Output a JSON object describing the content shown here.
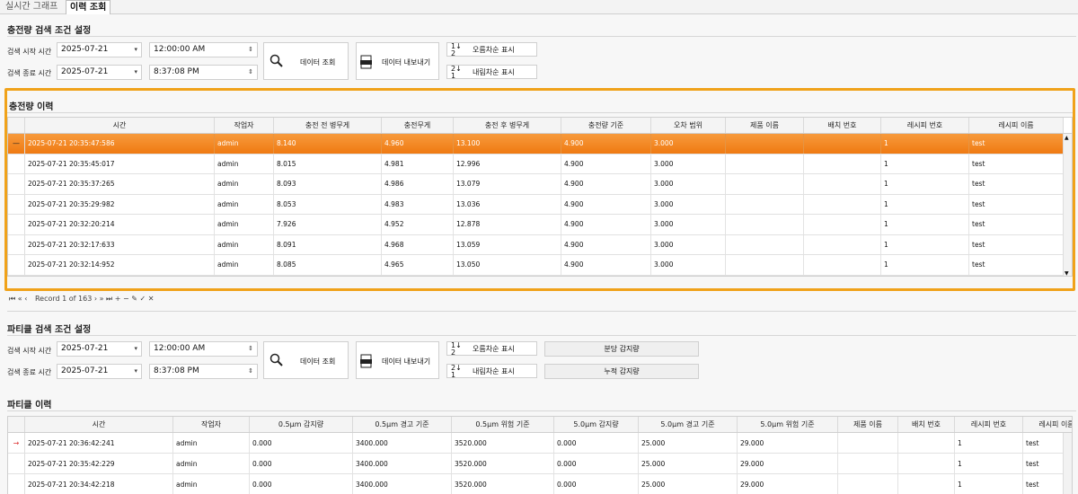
{
  "tabs": [
    {
      "label": "실시간 그래프"
    },
    {
      "label": "이력 조회"
    }
  ],
  "charge": {
    "search_title": "충전량 검색 조건 설정",
    "start_label": "검색 시작 시간",
    "end_label": "검색 종료 시간",
    "start_date": "2025-07-21",
    "start_time": "12:00:00 AM",
    "end_date": "2025-07-21",
    "end_time": "8:37:08 PM",
    "query_button": "데이터 조회",
    "export_button": "데이터 내보내기",
    "asc_button": "오름차순 표시",
    "desc_button": "내림차순 표시",
    "history_title": "충전량 이력",
    "columns": [
      "시간",
      "작업자",
      "충전 전 병무게",
      "충전무게",
      "충전 후 병무게",
      "충전량 기준",
      "오차 범위",
      "제품 이름",
      "배치 번호",
      "레시피 번호",
      "레시피 이름"
    ],
    "rows": [
      [
        "2025-07-21 20:35:47:586",
        "admin",
        "8.140",
        "4.960",
        "13.100",
        "4.900",
        "3.000",
        "",
        "",
        "1",
        "test"
      ],
      [
        "2025-07-21 20:35:45:017",
        "admin",
        "8.015",
        "4.981",
        "12.996",
        "4.900",
        "3.000",
        "",
        "",
        "1",
        "test"
      ],
      [
        "2025-07-21 20:35:37:265",
        "admin",
        "8.093",
        "4.986",
        "13.079",
        "4.900",
        "3.000",
        "",
        "",
        "1",
        "test"
      ],
      [
        "2025-07-21 20:35:29:982",
        "admin",
        "8.053",
        "4.983",
        "13.036",
        "4.900",
        "3.000",
        "",
        "",
        "1",
        "test"
      ],
      [
        "2025-07-21 20:32:20:214",
        "admin",
        "7.926",
        "4.952",
        "12.878",
        "4.900",
        "3.000",
        "",
        "",
        "1",
        "test"
      ],
      [
        "2025-07-21 20:32:17:633",
        "admin",
        "8.091",
        "4.968",
        "13.059",
        "4.900",
        "3.000",
        "",
        "",
        "1",
        "test"
      ],
      [
        "2025-07-21 20:32:14:952",
        "admin",
        "8.085",
        "4.965",
        "13.050",
        "4.900",
        "3.000",
        "",
        "",
        "1",
        "test"
      ]
    ],
    "record_text": "Record 1 of 163"
  },
  "particle": {
    "search_title": "파티클 검색 조건 설정",
    "start_label": "검색 시작 시간",
    "end_label": "검색 종료 시간",
    "start_date": "2025-07-21",
    "start_time": "12:00:00 AM",
    "end_date": "2025-07-21",
    "end_time": "8:37:08 PM",
    "query_button": "데이터 조회",
    "export_button": "데이터 내보내기",
    "asc_button": "오름차순 표시",
    "desc_button": "내림차순 표시",
    "minute_button": "분당 감지량",
    "cumulative_button": "누적 감지량",
    "history_title": "파티클 이력",
    "columns": [
      "시간",
      "작업자",
      "0.5μm 감지량",
      "0.5μm 경고 기준",
      "0.5μm 위험 기준",
      "5.0μm 감지량",
      "5.0μm 경고 기준",
      "5.0μm 위험 기준",
      "제품 이름",
      "배치 번호",
      "레시피 번호",
      "레시피 이름"
    ],
    "rows": [
      [
        "2025-07-21 20:36:42:241",
        "admin",
        "0.000",
        "3400.000",
        "3520.000",
        "0.000",
        "25.000",
        "29.000",
        "",
        "",
        "1",
        "test"
      ],
      [
        "2025-07-21 20:35:42:229",
        "admin",
        "0.000",
        "3400.000",
        "3520.000",
        "0.000",
        "25.000",
        "29.000",
        "",
        "",
        "1",
        "test"
      ],
      [
        "2025-07-21 20:34:42:218",
        "admin",
        "0.000",
        "3400.000",
        "3520.000",
        "0.000",
        "25.000",
        "29.000",
        "",
        "",
        "1",
        "test"
      ]
    ]
  },
  "colors": {
    "selection": "#ef7a12",
    "highlight": "#f0a21a"
  }
}
